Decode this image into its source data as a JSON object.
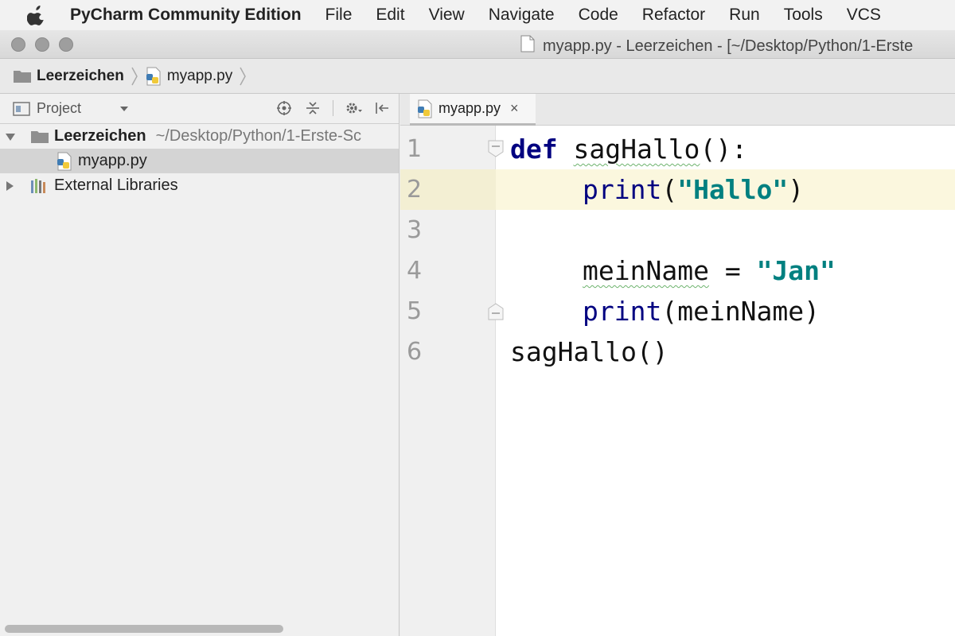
{
  "menubar": {
    "app_name": "PyCharm Community Edition",
    "items": [
      "File",
      "Edit",
      "View",
      "Navigate",
      "Code",
      "Refactor",
      "Run",
      "Tools",
      "VCS"
    ]
  },
  "window": {
    "title": "myapp.py - Leerzeichen - [~/Desktop/Python/1-Erste"
  },
  "breadcrumb": {
    "project": "Leerzeichen",
    "file": "myapp.py"
  },
  "project_panel": {
    "view_selector": "Project",
    "tree": {
      "root_name": "Leerzeichen",
      "root_path": "~/Desktop/Python/1-Erste-Sc",
      "file": "myapp.py",
      "external": "External Libraries"
    }
  },
  "editor": {
    "tab_label": "myapp.py",
    "tab_close": "×",
    "line_numbers": [
      "1",
      "2",
      "3",
      "4",
      "5",
      "6"
    ],
    "code": {
      "l1_kw": "def",
      "l1_name": "sagHallo",
      "l1_rest": "():",
      "l2_func": "print",
      "l2_open": "(",
      "l2_str": "\"Hallo\"",
      "l2_close": ")",
      "l4_var": "meinName",
      "l4_eq": " = ",
      "l4_str": "\"Jan\"",
      "l5_func": "print",
      "l5_args": "(meinName)",
      "l6_call": "sagHallo()"
    }
  },
  "colors": {
    "keyword": "#000080",
    "string": "#008080",
    "current_line": "#fbf7de"
  }
}
